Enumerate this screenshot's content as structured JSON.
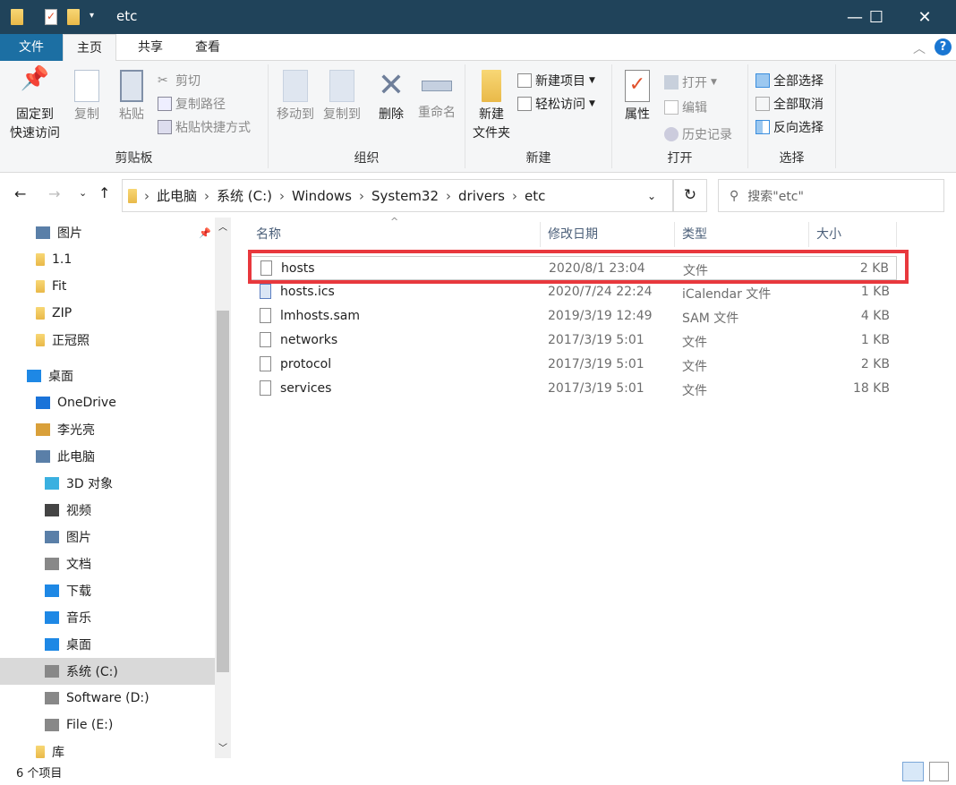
{
  "window": {
    "title": "etc"
  },
  "tabs": [
    "文件",
    "主页",
    "共享",
    "查看"
  ],
  "ribbon": {
    "clipboard": {
      "label": "剪贴板",
      "pin": "固定到\n快速访问",
      "copy": "复制",
      "paste": "粘贴",
      "cut": "剪切",
      "copy_path": "复制路径",
      "paste_shortcut": "粘贴快捷方式"
    },
    "organize": {
      "label": "组织",
      "move_to": "移动到",
      "copy_to": "复制到",
      "delete": "删除",
      "rename": "重命名"
    },
    "new": {
      "label": "新建",
      "new_folder": "新建\n文件夹",
      "new_item": "新建项目",
      "easy_access": "轻松访问"
    },
    "open": {
      "label": "打开",
      "properties": "属性",
      "open": "打开",
      "edit": "编辑",
      "history": "历史记录"
    },
    "select": {
      "label": "选择",
      "select_all": "全部选择",
      "select_none": "全部取消",
      "invert": "反向选择"
    }
  },
  "address": {
    "path": [
      "此电脑",
      "系统 (C:)",
      "Windows",
      "System32",
      "drivers",
      "etc"
    ],
    "search_placeholder": "搜索\"etc\""
  },
  "sidebar": [
    "图片",
    "1.1",
    "Fit",
    "ZIP",
    "正冠照",
    "桌面",
    "OneDrive",
    "李光亮",
    "此电脑",
    "3D 对象",
    "视频",
    "图片",
    "文档",
    "下载",
    "音乐",
    "桌面",
    "系统 (C:)",
    "Software (D:)",
    "File (E:)",
    "库"
  ],
  "columns": [
    "名称",
    "修改日期",
    "类型",
    "大小"
  ],
  "files": [
    {
      "name": "hosts",
      "date": "2020/8/1 23:04",
      "type": "文件",
      "size": "2 KB"
    },
    {
      "name": "hosts.ics",
      "date": "2020/7/24 22:24",
      "type": "iCalendar 文件",
      "size": "1 KB"
    },
    {
      "name": "lmhosts.sam",
      "date": "2019/3/19 12:49",
      "type": "SAM 文件",
      "size": "4 KB"
    },
    {
      "name": "networks",
      "date": "2017/3/19 5:01",
      "type": "文件",
      "size": "1 KB"
    },
    {
      "name": "protocol",
      "date": "2017/3/19 5:01",
      "type": "文件",
      "size": "2 KB"
    },
    {
      "name": "services",
      "date": "2017/3/19 5:01",
      "type": "文件",
      "size": "18 KB"
    }
  ],
  "status": {
    "count": "6 个项目"
  },
  "colors": {
    "titlebar": "#20435a",
    "file_tab": "#1c6fa3",
    "highlight": "#e8383d"
  }
}
